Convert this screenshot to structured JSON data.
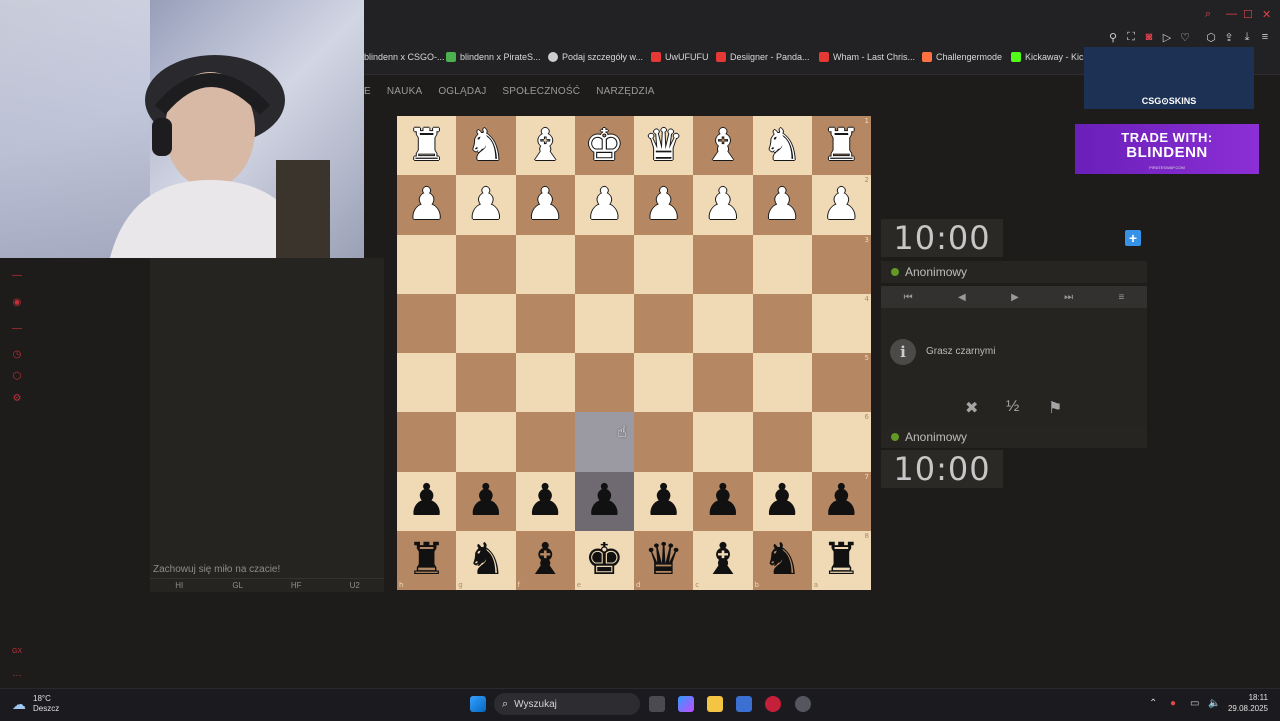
{
  "bookmarks": [
    {
      "label": "blindenn x CSGO-...",
      "icon_color": "#d8d8d8"
    },
    {
      "label": "blindenn x PirateS...",
      "icon_color": "#4caf50"
    },
    {
      "label": "Podaj szczegóły w...",
      "icon_color": "#cccccc"
    },
    {
      "label": "UwUFUFU",
      "icon_color": "#e53935"
    },
    {
      "label": "Desiigner - Panda...",
      "icon_color": "#e53935"
    },
    {
      "label": "Wham - Last Chris...",
      "icon_color": "#e53935"
    },
    {
      "label": "Challengermode",
      "icon_color": "#ff7043"
    },
    {
      "label": "Kickaway - Kick",
      "icon_color": "#53fc18"
    }
  ],
  "site_nav": [
    "E",
    "NAUKA",
    "OGLĄDAJ",
    "SPOŁECZNOŚĆ",
    "NARZĘDZIA"
  ],
  "chat": {
    "note": "Zachowuj się miło na czacie!",
    "tabs": [
      "HI",
      "GL",
      "HF",
      "U2"
    ]
  },
  "board": {
    "orientation": "black",
    "ranks": [
      "1",
      "2",
      "3",
      "4",
      "5",
      "6",
      "7",
      "8"
    ],
    "files": [
      "h",
      "g",
      "f",
      "e",
      "d",
      "c",
      "b",
      "a"
    ],
    "rows": [
      [
        "R",
        "N",
        "B",
        "K",
        "Q",
        "B",
        "N",
        "R"
      ],
      [
        "P",
        "P",
        "P",
        "P",
        "P",
        "P",
        "P",
        "P"
      ],
      [
        "",
        "",
        "",
        "",
        "",
        "",
        "",
        ""
      ],
      [
        "",
        "",
        "",
        "",
        "",
        "",
        "",
        ""
      ],
      [
        "",
        "",
        "",
        "",
        "",
        "",
        "",
        ""
      ],
      [
        "",
        "",
        "",
        "",
        "",
        "",
        "",
        ""
      ],
      [
        "p",
        "p",
        "p",
        "p",
        "p",
        "p",
        "p",
        "p"
      ],
      [
        "r",
        "n",
        "b",
        "k",
        "q",
        "b",
        "n",
        "r"
      ]
    ],
    "highlight_squares": [
      "e6",
      "e7"
    ]
  },
  "clocks": {
    "top": "10:00",
    "bottom": "10:00"
  },
  "players": {
    "top": "Anonimowy",
    "bottom": "Anonimowy",
    "online_color": "#629924"
  },
  "info_message": "Grasz czarnymi",
  "actions": {
    "abort": "✖",
    "draw": "½",
    "resign": "⚑"
  },
  "controls": [
    "⏮",
    "◀",
    "▶",
    "⏭",
    "≡"
  ],
  "overlays": {
    "csgo_label": "CSG⊙SKINS",
    "trade_line1": "TRADE WITH:",
    "trade_line2": "BLINDENN",
    "trade_line3": "PIRATESWAP.COM"
  },
  "taskbar": {
    "weather_temp": "18°C",
    "weather_desc": "Deszcz",
    "search_placeholder": "Wyszukaj",
    "time": "18:11",
    "date": "29.08.2025"
  },
  "colors": {
    "light_square": "#f0d9b5",
    "dark_square": "#b58863",
    "accent": "#3692e7"
  }
}
